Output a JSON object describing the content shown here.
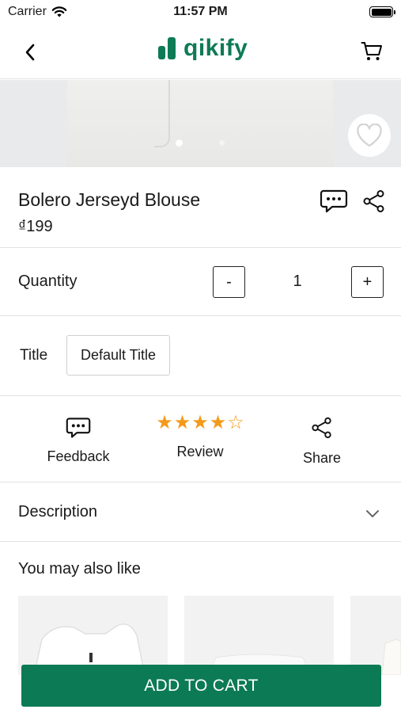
{
  "status_bar": {
    "carrier": "Carrier",
    "time": "11:57 PM",
    "icons": [
      "wifi-icon",
      "battery-icon"
    ]
  },
  "nav": {
    "logo_text": "qikify",
    "icons": [
      "back-chevron-icon",
      "cart-icon"
    ]
  },
  "gallery": {
    "image_count": 2,
    "active_index": 0,
    "favorite_icon": "heart-outline-icon"
  },
  "product": {
    "name": "Bolero Jerseyd Blouse",
    "price": "₫199",
    "icons": [
      "chat-bubble-icon",
      "share-icon"
    ]
  },
  "quantity": {
    "label": "Quantity",
    "minus": "-",
    "value": "1",
    "plus": "+"
  },
  "variant": {
    "label": "Title",
    "selected": "Default Title"
  },
  "actions": {
    "feedback": "Feedback",
    "review": "Review",
    "share": "Share",
    "rating": 4.5,
    "rating_max": 5
  },
  "description": {
    "label": "Description"
  },
  "related": {
    "title": "You may also like"
  },
  "cta": {
    "add_to_cart": "ADD TO CART"
  },
  "colors": {
    "brand": "#0c7a55",
    "star": "#f39a1a",
    "divider": "#e2e2e2"
  }
}
